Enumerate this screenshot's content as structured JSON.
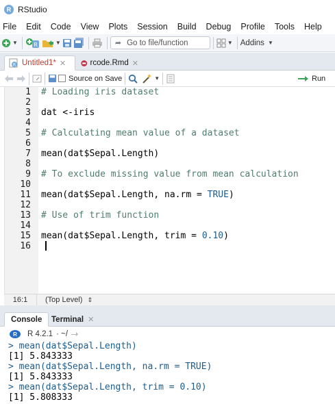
{
  "window": {
    "title": "RStudio"
  },
  "menu": [
    "File",
    "Edit",
    "Code",
    "View",
    "Plots",
    "Session",
    "Build",
    "Debug",
    "Profile",
    "Tools",
    "Help"
  ],
  "toolbar": {
    "goto_placeholder": "Go to file/function",
    "addins_label": "Addins"
  },
  "editor_tabs": [
    {
      "label": "Untitled1*",
      "active": true,
      "modified": true
    },
    {
      "label": "rcode.Rmd",
      "active": false,
      "modified": false
    }
  ],
  "editor_toolbar": {
    "source_on_save": "Source on Save",
    "run_label": "Run"
  },
  "code_lines": [
    {
      "n": "1",
      "text": "# Loading iris dataset",
      "kind": "comment"
    },
    {
      "n": "2",
      "text": "",
      "kind": "code"
    },
    {
      "n": "3",
      "text": "dat <-iris",
      "kind": "code"
    },
    {
      "n": "4",
      "text": "",
      "kind": "code"
    },
    {
      "n": "5",
      "text": "# Calculating mean value of a dataset",
      "kind": "comment"
    },
    {
      "n": "6",
      "text": "",
      "kind": "code"
    },
    {
      "n": "7",
      "text": "mean(dat$Sepal.Length)",
      "kind": "code"
    },
    {
      "n": "8",
      "text": "",
      "kind": "code"
    },
    {
      "n": "9",
      "text": "# To exclude missing value from mean calculation",
      "kind": "comment"
    },
    {
      "n": "10",
      "text": "",
      "kind": "code"
    },
    {
      "n": "11",
      "text": "mean(dat$Sepal.Length, na.rm = ",
      "tail_kw": "TRUE",
      "tail": ")",
      "kind": "code"
    },
    {
      "n": "12",
      "text": "",
      "kind": "code"
    },
    {
      "n": "13",
      "text": "# Use of trim function",
      "kind": "comment"
    },
    {
      "n": "14",
      "text": "",
      "kind": "code"
    },
    {
      "n": "15",
      "text": "mean(dat$Sepal.Length, trim = ",
      "tail_kw": "0.10",
      "tail": ")",
      "kind": "code"
    },
    {
      "n": "16",
      "text": "",
      "kind": "code"
    }
  ],
  "status": {
    "cursor_pos": "16:1",
    "scope": "(Top Level)"
  },
  "console_tabs": [
    {
      "label": "Console",
      "active": true
    },
    {
      "label": "Terminal",
      "active": false
    }
  ],
  "console_info": {
    "version": "R 4.2.1",
    "path": "· ~/"
  },
  "console_lines": [
    {
      "text": "> mean(dat$Sepal.Length)",
      "kind": "input"
    },
    {
      "text": "[1] 5.843333",
      "kind": "output"
    },
    {
      "text": "> mean(dat$Sepal.Length, na.rm = TRUE)",
      "kind": "input"
    },
    {
      "text": "[1] 5.843333",
      "kind": "output"
    },
    {
      "text": "> mean(dat$Sepal.Length, trim = 0.10)",
      "kind": "input"
    },
    {
      "text": "[1] 5.808333",
      "kind": "output"
    }
  ],
  "colors": {
    "comment": "#4e7d6e",
    "keyword": "#1c5c8e",
    "console_input": "#1c5c8e",
    "modified_tab": "#c83a29"
  }
}
